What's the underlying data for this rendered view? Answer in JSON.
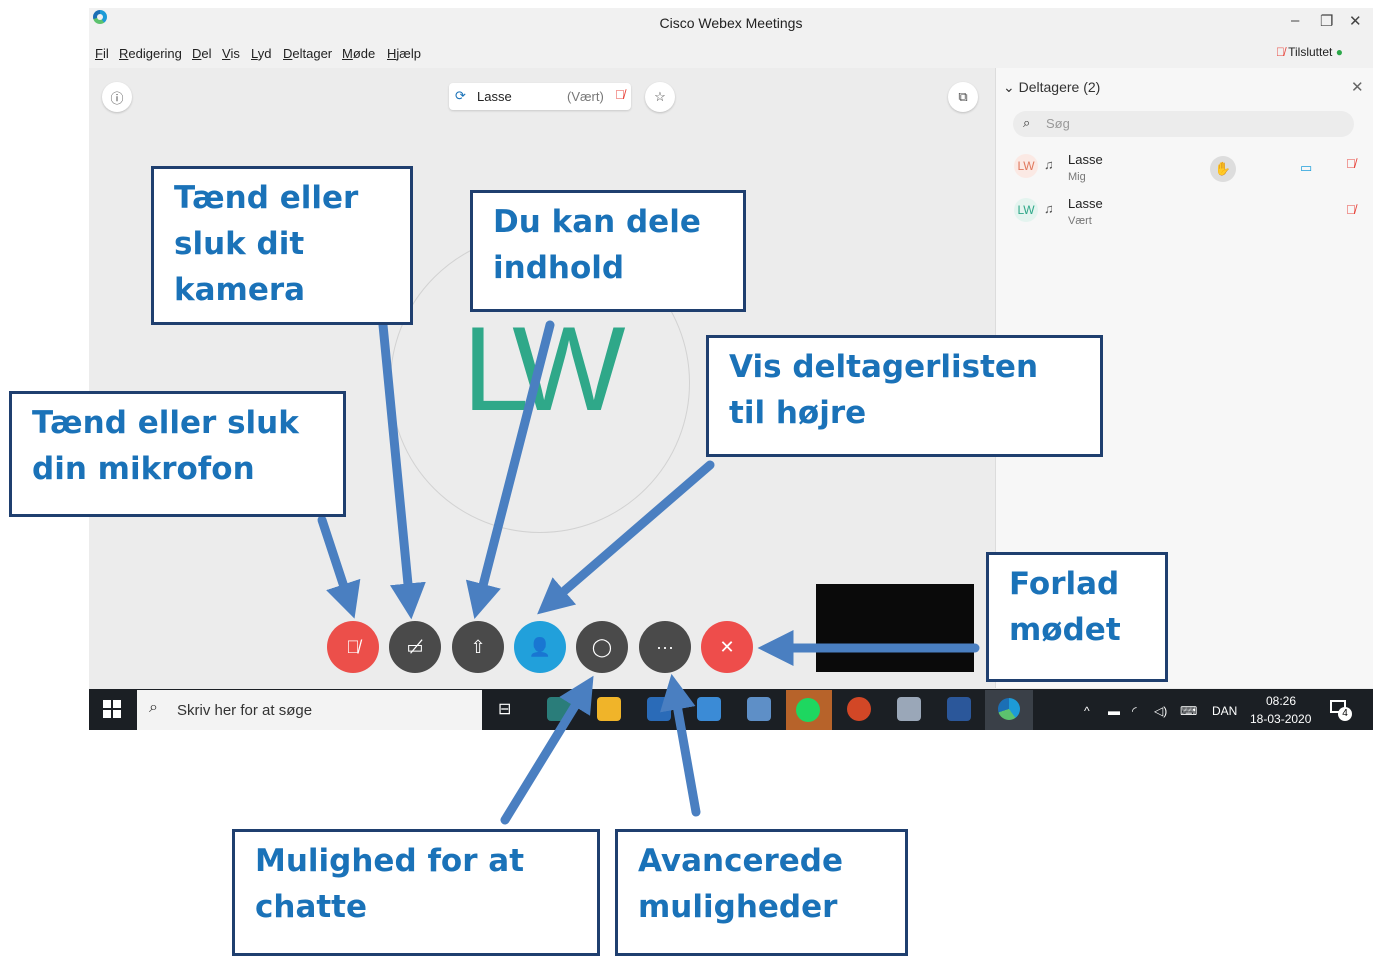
{
  "window": {
    "title": "Cisco Webex Meetings",
    "controls": [
      "–",
      "❐",
      "✕"
    ]
  },
  "menubar": {
    "items": [
      "Fil",
      "Redigering",
      "Del",
      "Vis",
      "Lyd",
      "Deltager",
      "Møde",
      "Hjælp"
    ],
    "status": "Tilsluttet"
  },
  "stage": {
    "presenter_name": "Lasse",
    "presenter_role": "(Vært)",
    "initials": "LW"
  },
  "participants_panel": {
    "title": "Deltagere (2)",
    "search_placeholder": "Søg",
    "items": [
      {
        "initials": "LW",
        "name": "Lasse",
        "role": "Mig"
      },
      {
        "initials": "LW",
        "name": "Lasse",
        "role": "Vært"
      }
    ]
  },
  "controls": {
    "mute_color": "#ec4f4a",
    "dark_color": "#4a4a4a",
    "participants_color": "#21a0db",
    "leave_color": "#ee4d4b",
    "more_label": "···"
  },
  "taskbar": {
    "search_placeholder": "Skriv her for at søge",
    "language": "DAN",
    "time": "08:26",
    "date": "18-03-2020",
    "notifications": "4"
  },
  "annotations": {
    "camera": "Tænd eller\nsluk dit\nkamera",
    "share": "Du kan dele\nindhold",
    "participants": "Vis deltagerlisten\ntil højre",
    "microphone": "Tænd eller sluk\ndin mikrofon",
    "leave": "Forlad\nmødet",
    "chat": "Mulighed for at\nchatte",
    "advanced": "Avancerede\nmuligheder"
  },
  "colors": {
    "annotation_text": "#1a72b8",
    "annotation_border": "#1f3f6f",
    "arrow": "#4a7fc1",
    "avatar": "#2fa889"
  }
}
